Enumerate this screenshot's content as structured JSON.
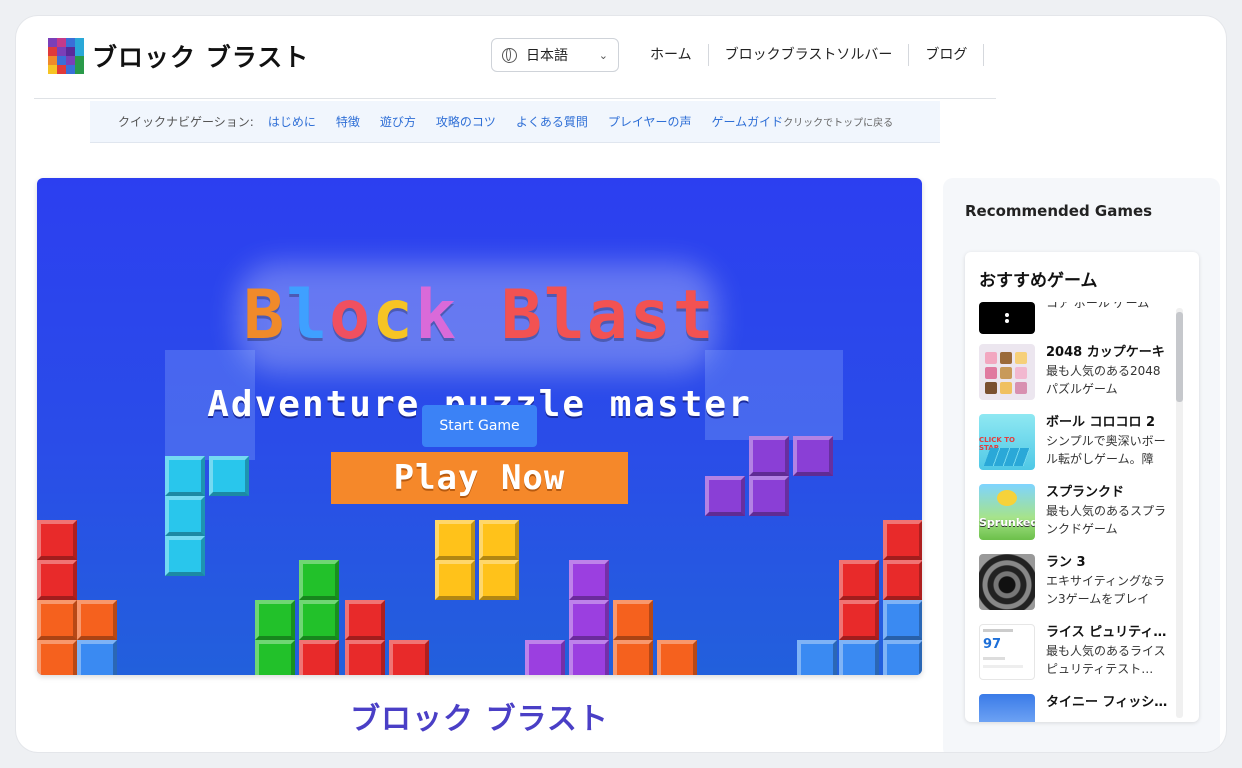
{
  "header": {
    "site_title": "ブロック ブラスト",
    "language": "日本語",
    "nav": [
      "ホーム",
      "ブロックブラストソルバー",
      "ブログ"
    ]
  },
  "quick_nav": {
    "label": "クイックナビゲーション:",
    "links": [
      "はじめに",
      "特徴",
      "遊び方",
      "攻略のコツ",
      "よくある質問",
      "プレイヤーの声",
      "ゲームガイド"
    ],
    "back_to_top": "クリックでトップに戻る"
  },
  "hero": {
    "title_letters": [
      "B",
      "l",
      "o",
      "c",
      "k",
      " ",
      "B",
      "l",
      "a",
      "s",
      "t"
    ],
    "subtitle": "Adventure puzzle master",
    "play_now": "Play Now",
    "start_button": "Start Game"
  },
  "page_title": "ブロック ブラスト",
  "sidebar": {
    "heading": "Recommended Games",
    "card_title": "おすすめゲーム",
    "games": [
      {
        "name": "",
        "desc": "コア ボール ゲーム"
      },
      {
        "name": "2048 カップケーキ",
        "desc": "最も人気のある2048パズルゲーム"
      },
      {
        "name": "ボール コロコロ 2",
        "desc": "シンプルで奥深いボール転がしゲーム。障"
      },
      {
        "name": "スプランクド",
        "desc": "最も人気のあるスプランクドゲーム"
      },
      {
        "name": "ラン 3",
        "desc": "エキサイティングなラン3ゲームをプレイ"
      },
      {
        "name": "ライス ピュリティテスト",
        "desc": "最も人気のあるライスピュリティテスト…"
      },
      {
        "name": "タイニー フィッシング",
        "desc": ""
      }
    ],
    "thumb_texts": {
      "sprunked": "Sprunked",
      "ball": "CLICK TO STAR",
      "rice": "97"
    }
  },
  "colors": {
    "accent": "#2f6fd6",
    "title_purple": "#4a3fc6",
    "start_button": "#3b82f6",
    "play_now": "#f5882a",
    "title_letter_colors": [
      "#f08a2a",
      "#3fa0ff",
      "#f05060",
      "#f6c424",
      "#d96ad9",
      "#ffffff",
      "#f25252",
      "#f25252",
      "#f25252",
      "#f25252",
      "#f25252"
    ]
  }
}
